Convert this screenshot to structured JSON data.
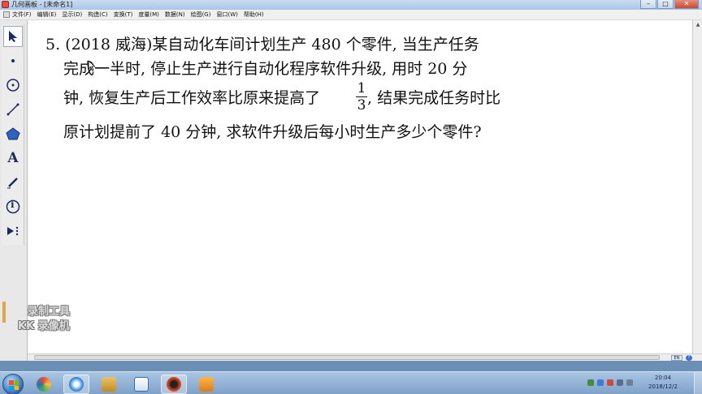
{
  "window": {
    "title": "几何画板 - [未命名1]",
    "minimize": "–",
    "maximize": "□",
    "close": "✕"
  },
  "menu": [
    {
      "label": "文件(F)"
    },
    {
      "label": "编辑(E)"
    },
    {
      "label": "显示(D)"
    },
    {
      "label": "构造(C)"
    },
    {
      "label": "变换(T)"
    },
    {
      "label": "度量(M)"
    },
    {
      "label": "数据(N)"
    },
    {
      "label": "绘图(G)"
    },
    {
      "label": "窗口(W)"
    },
    {
      "label": "帮助(H)"
    }
  ],
  "toolbox": {
    "text_tool": "A",
    "info_tool": "i"
  },
  "problem": {
    "line1": "5. (2018 威海)某自动化车间计划生产 480 个零件, 当生产任务",
    "line2": "完成一半时, 停止生产进行自动化程序软件升级, 用时  20  分",
    "line3_before": "钟, 恢复生产后工作效率比原来提高了",
    "fraction_num": "1",
    "fraction_den": "3",
    "line3_after": ", 结果完成任务时比",
    "line4": "原计划提前了 40 分钟, 求软件升级后每小时生产多少个零件?"
  },
  "watermark": {
    "line1": "录制工具",
    "line2": "KK 录像机"
  },
  "statusbar": {
    "lang": "EN",
    "help": "?"
  },
  "taskbar": {
    "time": "20:04",
    "date": "2018/12/2"
  },
  "colors": {
    "taskbar": "#7fa1c9",
    "canvas": "#ffffff",
    "text": "#111111"
  }
}
